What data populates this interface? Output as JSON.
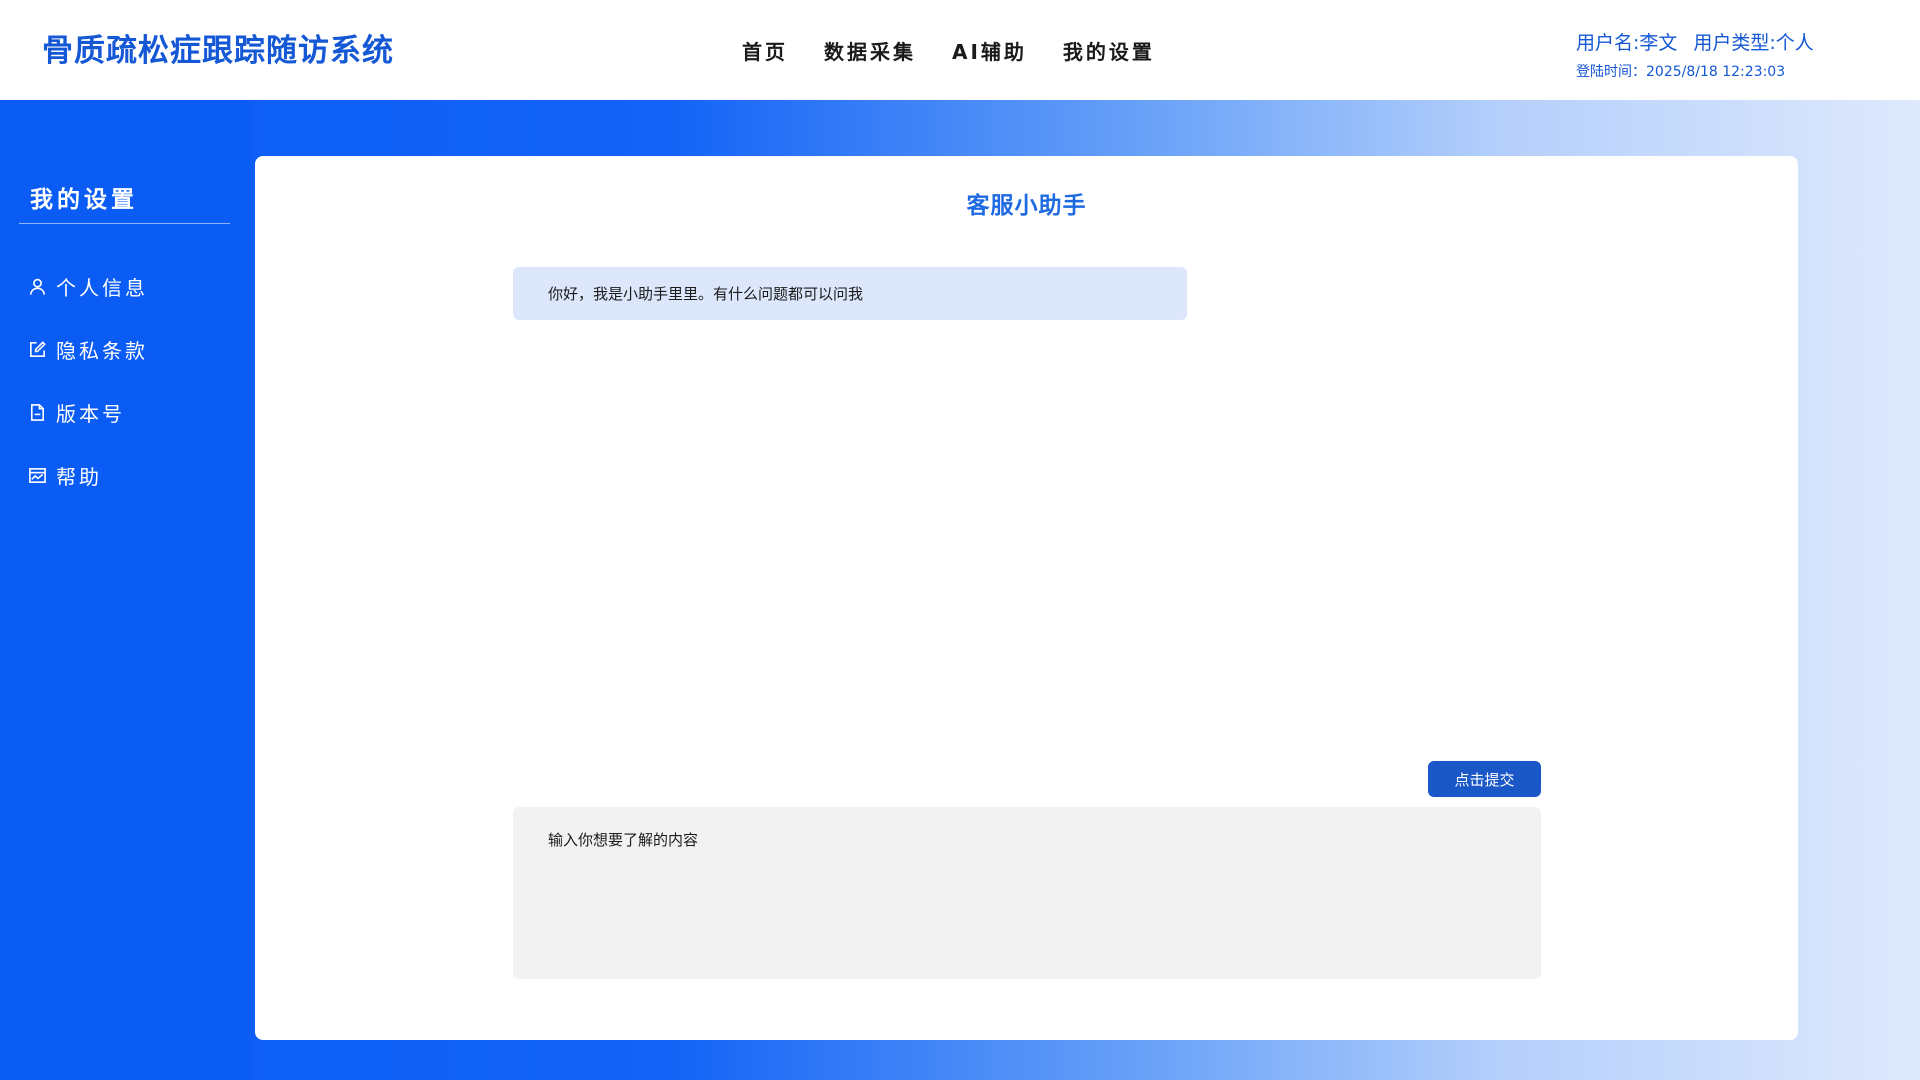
{
  "header": {
    "app_title": "骨质疏松症跟踪随访系统",
    "nav": [
      "首页",
      "数据采集",
      "AI辅助",
      "我的设置"
    ],
    "user_name": "用户名:李文",
    "user_type": "用户类型:个人",
    "login_time": "登陆时间：2025/8/18 12:23:03"
  },
  "sidebar": {
    "title": "我的设置",
    "items": [
      {
        "label": "个人信息",
        "icon": "user-icon"
      },
      {
        "label": "隐私条款",
        "icon": "edit-icon"
      },
      {
        "label": "版本号",
        "icon": "document-icon"
      },
      {
        "label": "帮助",
        "icon": "image-icon"
      }
    ]
  },
  "chat": {
    "title": "客服小助手",
    "bot_message": "你好，我是小助手里里。有什么问题都可以问我",
    "submit_label": "点击提交",
    "input_placeholder": "输入你想要了解的内容"
  },
  "colors": {
    "brand": "#1558d6",
    "sidebar_bg": "#0a5cf5",
    "bubble_bg": "#dce7fc",
    "button_bg": "#1a58c8"
  }
}
